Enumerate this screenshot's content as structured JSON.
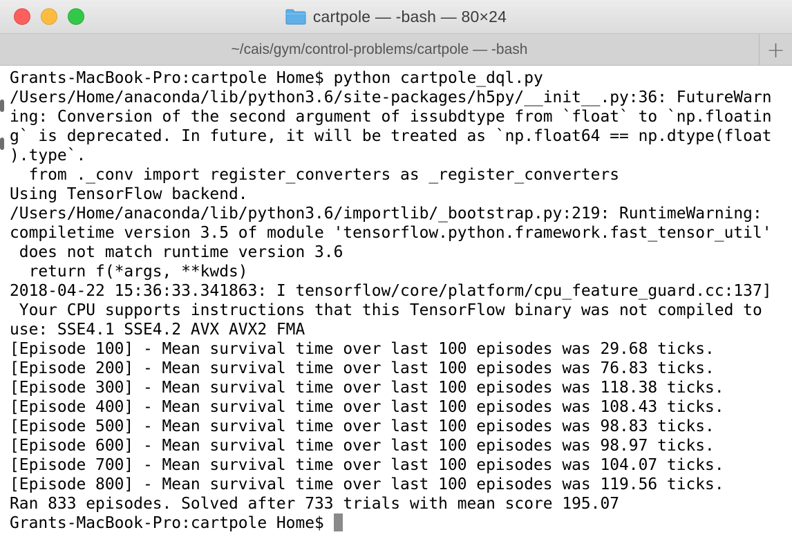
{
  "window": {
    "title": "cartpole — -bash — 80×24",
    "colors": {
      "close": "#fc605c",
      "minimize": "#fdbc40",
      "zoom": "#34c84a",
      "folder": "#5fb0e8"
    }
  },
  "tab": {
    "label": "~/cais/gym/control-problems/cartpole — -bash",
    "new_tab_label": "+"
  },
  "terminal": {
    "lines": [
      "Grants-MacBook-Pro:cartpole Home$ python cartpole_dql.py",
      "/Users/Home/anaconda/lib/python3.6/site-packages/h5py/__init__.py:36: FutureWarn",
      "ing: Conversion of the second argument of issubdtype from `float` to `np.floatin",
      "g` is deprecated. In future, it will be treated as `np.float64 == np.dtype(float",
      ").type`.",
      "  from ._conv import register_converters as _register_converters",
      "Using TensorFlow backend.",
      "/Users/Home/anaconda/lib/python3.6/importlib/_bootstrap.py:219: RuntimeWarning:",
      "compiletime version 3.5 of module 'tensorflow.python.framework.fast_tensor_util'",
      " does not match runtime version 3.6",
      "  return f(*args, **kwds)",
      "2018-04-22 15:36:33.341863: I tensorflow/core/platform/cpu_feature_guard.cc:137]",
      " Your CPU supports instructions that this TensorFlow binary was not compiled to",
      "use: SSE4.1 SSE4.2 AVX AVX2 FMA",
      "[Episode 100] - Mean survival time over last 100 episodes was 29.68 ticks.",
      "[Episode 200] - Mean survival time over last 100 episodes was 76.83 ticks.",
      "[Episode 300] - Mean survival time over last 100 episodes was 118.38 ticks.",
      "[Episode 400] - Mean survival time over last 100 episodes was 108.43 ticks.",
      "[Episode 500] - Mean survival time over last 100 episodes was 98.83 ticks.",
      "[Episode 600] - Mean survival time over last 100 episodes was 98.97 ticks.",
      "[Episode 700] - Mean survival time over last 100 episodes was 104.07 ticks.",
      "[Episode 800] - Mean survival time over last 100 episodes was 119.56 ticks.",
      "Ran 833 episodes. Solved after 733 trials with mean score 195.07"
    ],
    "prompt": "Grants-MacBook-Pro:cartpole Home$"
  }
}
